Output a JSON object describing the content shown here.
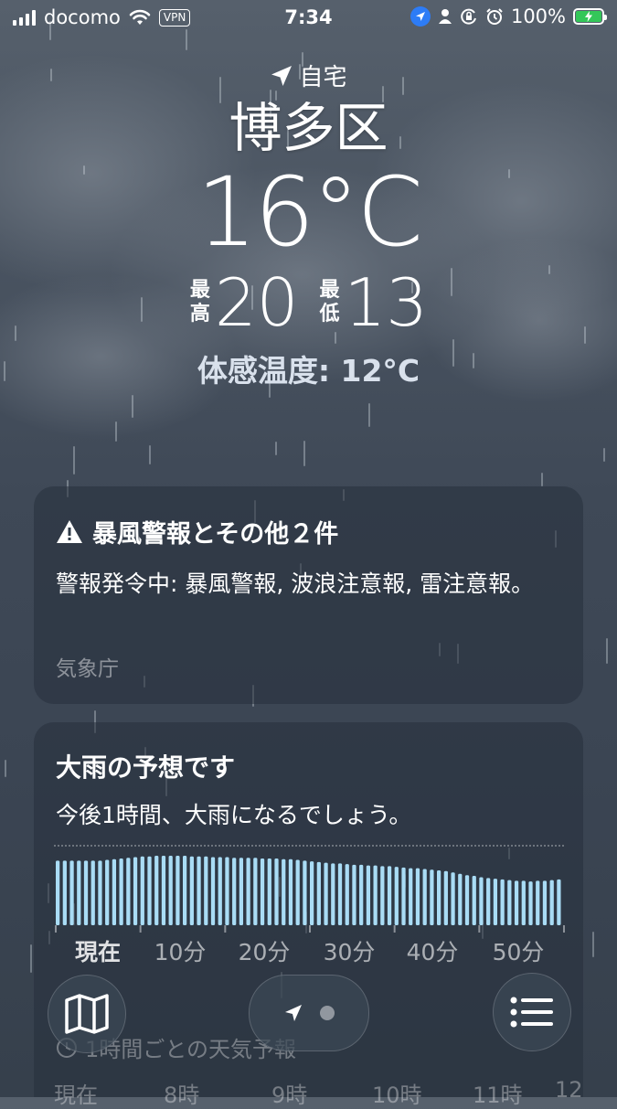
{
  "status_bar": {
    "carrier": "docomo",
    "vpn": "VPN",
    "time": "7:34",
    "battery": "100%"
  },
  "location": {
    "label": "自宅",
    "city": "博多区"
  },
  "current": {
    "temperature": "16°C",
    "high_label": "最高",
    "high": "20",
    "low_label": "最低",
    "low": "13",
    "feels_like": "体感温度: 12°C"
  },
  "alert": {
    "title": "暴風警報とその他２件",
    "body": "警報発令中: 暴風警報, 波浪注意報, 雷注意報。",
    "source": "気象庁"
  },
  "precip": {
    "title": "大雨の予想です",
    "subtitle": "今後1時間、大雨になるでしょう。",
    "axis_labels": [
      "現在",
      "10分",
      "20分",
      "30分",
      "40分",
      "50分"
    ]
  },
  "hourly": {
    "title": "1時間ごとの天気予報",
    "hours": [
      "現在",
      "8時",
      "9時",
      "10時",
      "11時",
      "12"
    ]
  },
  "chart_data": {
    "type": "bar",
    "title": "",
    "xlabel": "",
    "ylabel": "",
    "x_labels": [
      "現在",
      "10分",
      "20分",
      "30分",
      "40分",
      "50分"
    ],
    "ylim": [
      0,
      1
    ],
    "values": [
      0.93,
      0.93,
      0.93,
      0.93,
      0.93,
      0.93,
      0.93,
      0.94,
      0.95,
      0.96,
      0.97,
      0.98,
      0.99,
      0.99,
      1.0,
      1.0,
      1.0,
      1.0,
      1.0,
      0.99,
      0.99,
      0.99,
      0.98,
      0.98,
      0.98,
      0.97,
      0.97,
      0.97,
      0.97,
      0.96,
      0.96,
      0.96,
      0.95,
      0.95,
      0.94,
      0.93,
      0.92,
      0.91,
      0.9,
      0.89,
      0.89,
      0.88,
      0.87,
      0.87,
      0.86,
      0.86,
      0.85,
      0.85,
      0.84,
      0.83,
      0.82,
      0.82,
      0.81,
      0.8,
      0.79,
      0.78,
      0.76,
      0.74,
      0.72,
      0.71,
      0.69,
      0.68,
      0.67,
      0.66,
      0.65,
      0.64,
      0.64,
      0.63,
      0.64,
      0.64,
      0.65,
      0.66
    ],
    "color": "#a9dcf5"
  }
}
